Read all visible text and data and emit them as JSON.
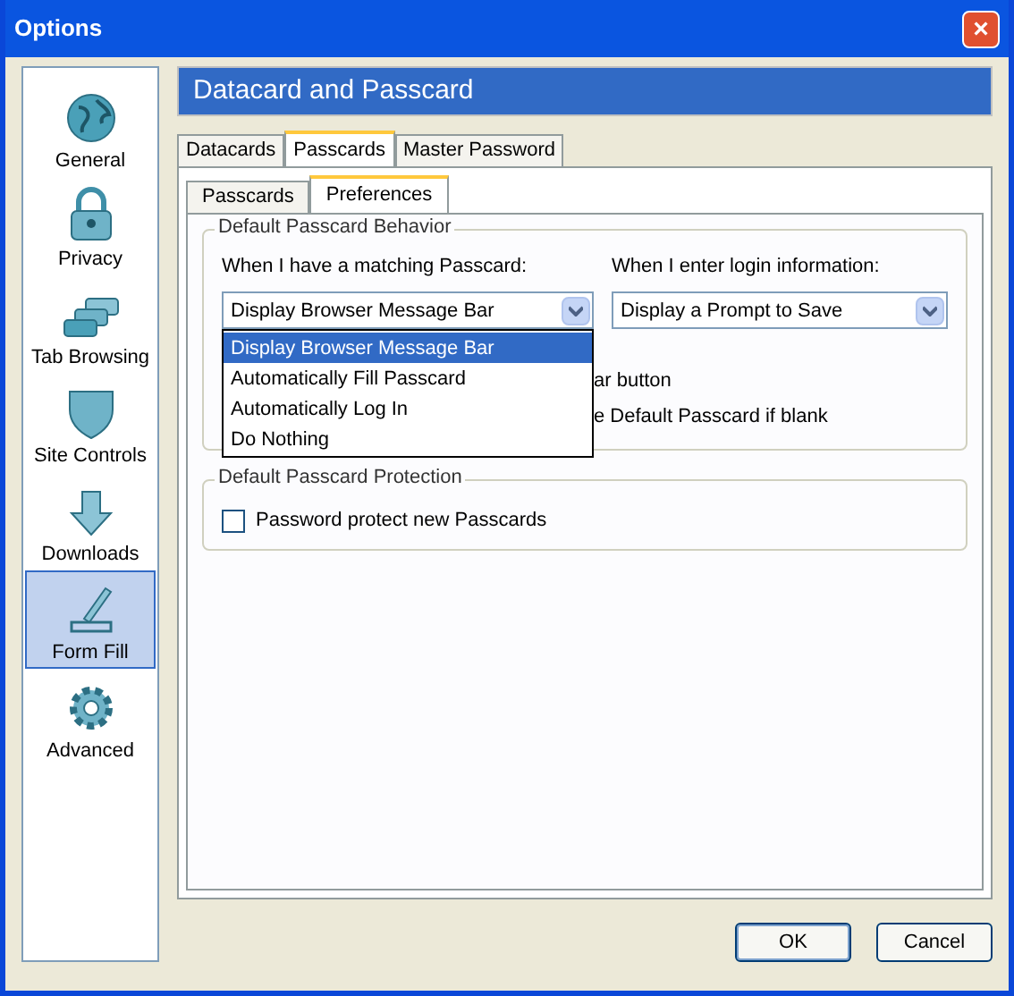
{
  "window": {
    "title": "Options",
    "close": "×"
  },
  "sidebar": {
    "items": [
      {
        "label": "General",
        "kind": "globe",
        "selected": false
      },
      {
        "label": "Privacy",
        "kind": "lock",
        "selected": false
      },
      {
        "label": "Tab Browsing",
        "kind": "tabs",
        "selected": false
      },
      {
        "label": "Site Controls",
        "kind": "shield",
        "selected": false
      },
      {
        "label": "Downloads",
        "kind": "download",
        "selected": false
      },
      {
        "label": "Form Fill",
        "kind": "pen",
        "selected": true
      },
      {
        "label": "Advanced",
        "kind": "gear",
        "selected": false
      }
    ]
  },
  "header": "Datacard and Passcard",
  "tabs": [
    {
      "label": "Datacards",
      "selected": false
    },
    {
      "label": "Passcards",
      "selected": true
    },
    {
      "label": "Master Password",
      "selected": false
    }
  ],
  "subtabs": [
    {
      "label": "Passcards",
      "selected": false
    },
    {
      "label": "Preferences",
      "selected": true
    }
  ],
  "behavior": {
    "legend": "Default Passcard Behavior",
    "matching": {
      "label": "When I have a matching Passcard:",
      "value": "Display Browser Message Bar",
      "expanded": true,
      "options": [
        {
          "label": "Display Browser Message Bar",
          "selected": true
        },
        {
          "label": "Automatically Fill Passcard",
          "selected": false
        },
        {
          "label": "Automatically Log In",
          "selected": false
        },
        {
          "label": "Do Nothing",
          "selected": false
        }
      ]
    },
    "login": {
      "label": "When I enter login information:",
      "value": "Display a Prompt to Save"
    },
    "hidden_rows": [
      "ar button",
      "e Default Passcard if blank"
    ]
  },
  "protection": {
    "legend": "Default Passcard Protection",
    "checkbox": {
      "label": "Password protect new Passcards",
      "checked": false
    }
  },
  "buttons": [
    "OK",
    "Cancel"
  ]
}
